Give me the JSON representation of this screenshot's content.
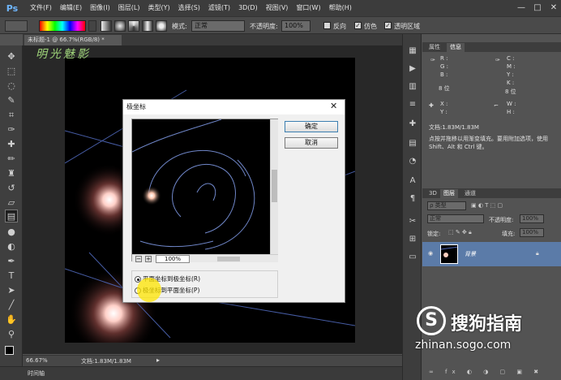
{
  "app": {
    "logo": "Ps"
  },
  "menu": [
    "文件(F)",
    "编辑(E)",
    "图像(I)",
    "图层(L)",
    "类型(Y)",
    "选择(S)",
    "滤镜(T)",
    "3D(D)",
    "视图(V)",
    "窗口(W)",
    "帮助(H)"
  ],
  "window_controls": [
    "—",
    "□",
    "✕"
  ],
  "options": {
    "mode_label": "模式:",
    "mode_value": "正常",
    "opacity_label": "不透明度:",
    "opacity_value": "100%",
    "reverse_label": "反向",
    "dither_label": "仿色",
    "transparency_label": "透明区域"
  },
  "document": {
    "tab_title": "未标题-1 @ 66.7%(RGB/8) *",
    "overlay_text": "明光魅影"
  },
  "status": {
    "zoom": "66.67%",
    "doc_info": "文档:1.83M/1.83M"
  },
  "timeline": {
    "label": "时间轴"
  },
  "dialog": {
    "title": "极坐标",
    "ok": "确定",
    "cancel": "取消",
    "zoom": "100%",
    "zoom_out": "−",
    "zoom_in": "+",
    "option_rect_to_polar": "平面坐标到极坐标(R)",
    "option_polar_to_rect": "极坐标到平面坐标(P)"
  },
  "info_panel": {
    "tabs": [
      "属性",
      "信息"
    ],
    "r": "R :",
    "g": "G :",
    "b": "B :",
    "c": "C :",
    "m": "M :",
    "y": "Y :",
    "k": "K :",
    "bit1": "8 位",
    "bit2": "8 位",
    "x": "X :",
    "yy": "Y :",
    "w": "W :",
    "h": "H :",
    "doc": "文档:1.83M/1.83M",
    "hint": "点按并拖移以用渐变填充。要用附加选项，使用 Shift、Alt 和 Ctrl 键。"
  },
  "layers_panel": {
    "tabs": [
      "3D",
      "图层",
      "通道"
    ],
    "kind": "ρ 类型",
    "blend": "正常",
    "opacity_label": "不透明度:",
    "opacity_value": "100%",
    "lock_label": "锁定:",
    "fill_label": "填充:",
    "fill_value": "100%",
    "layer_name": "背景"
  },
  "brand_watermark": {
    "name": "搜狗指南",
    "url": "zhinan.sogo.com"
  }
}
